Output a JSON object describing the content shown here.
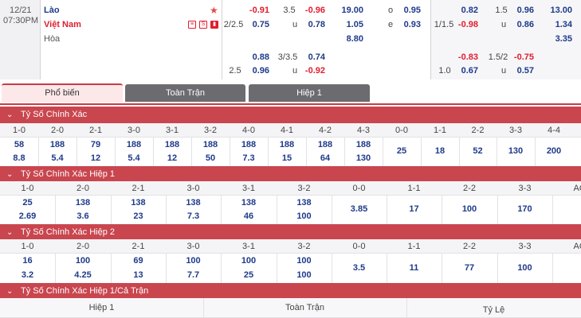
{
  "match": {
    "date": "12/21",
    "time": "07:30PM",
    "home": "Lào",
    "away": "Việt Nam",
    "draw": "Hòa",
    "icons": [
      "card-icon",
      "s-icon",
      "stats-icon"
    ],
    "fulltime": {
      "hdp_line_1": "2/2.5",
      "hdp_home_1": "-0.91",
      "hdp_away_1": "0.75",
      "ou_line_1": "3.5",
      "ou_over_1": "-0.96",
      "ou_u_1": "u",
      "ou_under_1": "0.78",
      "x12_home": "19.00",
      "x12_away": "1.05",
      "x12_draw": "8.80",
      "oe_o": "o",
      "oe_o_val": "0.95",
      "oe_e": "e",
      "oe_e_val": "0.93",
      "hdp_line_2": "2.5",
      "hdp_home_2": "0.88",
      "hdp_away_2": "0.96",
      "ou_line_2": "3/3.5",
      "ou_over_2": "0.74",
      "ou_u_2": "u",
      "ou_under_2": "-0.92"
    },
    "firsthalf": {
      "hdp_line_1": "1/1.5",
      "hdp_home_1": "0.82",
      "hdp_away_1": "-0.98",
      "ou_line_1": "1.5",
      "ou_over_1": "0.96",
      "ou_u_1": "u",
      "ou_under_1": "0.86",
      "x12_home": "13.00",
      "x12_away": "1.34",
      "x12_draw": "3.35",
      "hdp_line_2": "1.0",
      "hdp_home_2": "-0.83",
      "hdp_away_2": "0.67",
      "ou_line_2": "1.5/2",
      "ou_over_2": "-0.75",
      "ou_u_2": "u",
      "ou_under_2": "0.57"
    }
  },
  "tabs": [
    {
      "label": "Phổ biến",
      "active": true
    },
    {
      "label": "Toàn Trận",
      "active": false
    },
    {
      "label": "Hiệp 1",
      "active": false
    }
  ],
  "sections": {
    "exact": {
      "title": "Tỷ Số Chính Xác",
      "cols": [
        {
          "h": "1-0",
          "a": "58",
          "b": "8.8"
        },
        {
          "h": "2-0",
          "a": "188",
          "b": "5.4"
        },
        {
          "h": "2-1",
          "a": "79",
          "b": "12"
        },
        {
          "h": "3-0",
          "a": "188",
          "b": "5.4"
        },
        {
          "h": "3-1",
          "a": "188",
          "b": "12"
        },
        {
          "h": "3-2",
          "a": "188",
          "b": "50"
        },
        {
          "h": "4-0",
          "a": "188",
          "b": "7.3"
        },
        {
          "h": "4-1",
          "a": "188",
          "b": "15"
        },
        {
          "h": "4-2",
          "a": "188",
          "b": "64"
        },
        {
          "h": "4-3",
          "a": "188",
          "b": "130"
        },
        {
          "h": "0-0",
          "a": "25"
        },
        {
          "h": "1-1",
          "a": "18"
        },
        {
          "h": "2-2",
          "a": "52"
        },
        {
          "h": "3-3",
          "a": "130"
        },
        {
          "h": "4-4",
          "a": "200"
        }
      ]
    },
    "exact_h1": {
      "title": "Tỷ Số Chính Xác Hiệp 1",
      "cols": [
        {
          "h": "1-0",
          "a": "25",
          "b": "2.69"
        },
        {
          "h": "2-0",
          "a": "138",
          "b": "3.6"
        },
        {
          "h": "2-1",
          "a": "138",
          "b": "23"
        },
        {
          "h": "3-0",
          "a": "138",
          "b": "7.3"
        },
        {
          "h": "3-1",
          "a": "138",
          "b": "46"
        },
        {
          "h": "3-2",
          "a": "138",
          "b": "100"
        },
        {
          "h": "0-0",
          "a": "3.85"
        },
        {
          "h": "1-1",
          "a": "17"
        },
        {
          "h": "2-2",
          "a": "100"
        },
        {
          "h": "3-3",
          "a": "170"
        },
        {
          "h": "AO",
          "a": ""
        }
      ]
    },
    "exact_h2": {
      "title": "Tỷ Số Chính Xác Hiệp 2",
      "cols": [
        {
          "h": "1-0",
          "a": "16",
          "b": "3.2"
        },
        {
          "h": "2-0",
          "a": "100",
          "b": "4.25"
        },
        {
          "h": "2-1",
          "a": "69",
          "b": "13"
        },
        {
          "h": "3-0",
          "a": "100",
          "b": "7.7"
        },
        {
          "h": "3-1",
          "a": "100",
          "b": "25"
        },
        {
          "h": "3-2",
          "a": "100",
          "b": "100"
        },
        {
          "h": "0-0",
          "a": "3.5"
        },
        {
          "h": "1-1",
          "a": "11"
        },
        {
          "h": "2-2",
          "a": "77"
        },
        {
          "h": "3-3",
          "a": "100"
        },
        {
          "h": "AO",
          "a": ""
        }
      ]
    },
    "htft": {
      "title": "Tỷ Số Chính Xác Hiệp 1/Cả Trận",
      "headers": [
        "Hiệp 1",
        "Toàn Trận",
        "Tỷ Lệ"
      ]
    }
  },
  "colors": {
    "accent": "#c9464f",
    "negative": "#e11d2e",
    "positive": "#1e3a8a"
  }
}
